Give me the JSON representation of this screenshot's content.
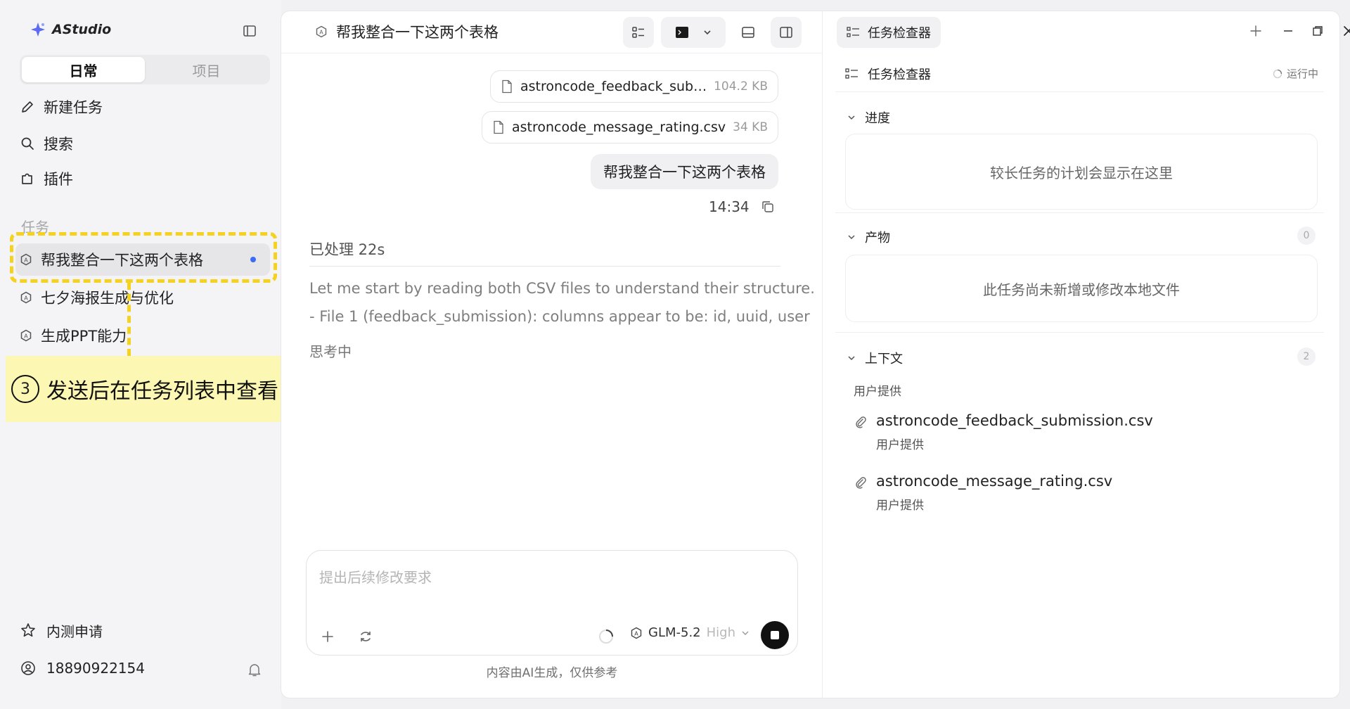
{
  "brand": {
    "name": "AStudio"
  },
  "tabs": [
    {
      "label": "日常"
    },
    {
      "label": "项目"
    }
  ],
  "nav": {
    "new_task": "新建任务",
    "search": "搜索",
    "plugins": "插件"
  },
  "tasks_section": "任务",
  "tasks": [
    {
      "label": "帮我整合一下这两个表格"
    },
    {
      "label": "七夕海报生成与优化"
    },
    {
      "label": "生成PPT能力"
    }
  ],
  "callout": {
    "number": "3",
    "text": "发送后在任务列表中查看"
  },
  "footer": {
    "beta": "内测申请",
    "account": "18890922154"
  },
  "chat": {
    "title": "帮我整合一下这两个表格",
    "files": [
      {
        "name": "astroncode_feedback_sub…",
        "size": "104.2 KB"
      },
      {
        "name": "astroncode_message_rating.csv",
        "size": "34 KB"
      }
    ],
    "user_message": "帮我整合一下这两个表格",
    "time": "14:34",
    "processed": "已处理 22s",
    "reasoning": [
      "Let me start by reading both CSV files to understand their structure.",
      "- File 1 (feedback_submission): columns appear to be: id, uuid, user"
    ],
    "thinking": "思考中",
    "composer_placeholder": "提出后续修改要求",
    "model": "GLM-5.2",
    "effort": "High",
    "disclaimer": "内容由AI生成，仅供参考"
  },
  "inspector": {
    "tab": "任务检查器",
    "title": "任务检查器",
    "status": "运行中",
    "progress": {
      "title": "进度",
      "empty": "较长任务的计划会显示在这里"
    },
    "artifacts": {
      "title": "产物",
      "count": "0",
      "empty": "此任务尚未新增或修改本地文件"
    },
    "context": {
      "title": "上下文",
      "count": "2",
      "source_label": "用户提供",
      "files": [
        {
          "name": "astroncode_feedback_submission.csv",
          "source": "用户提供"
        },
        {
          "name": "astroncode_message_rating.csv",
          "source": "用户提供"
        }
      ]
    }
  },
  "colors": {
    "accent_dot": "#3b6cf6",
    "callout": "#f4d21f",
    "callout_bg": "#fcf7b2"
  }
}
